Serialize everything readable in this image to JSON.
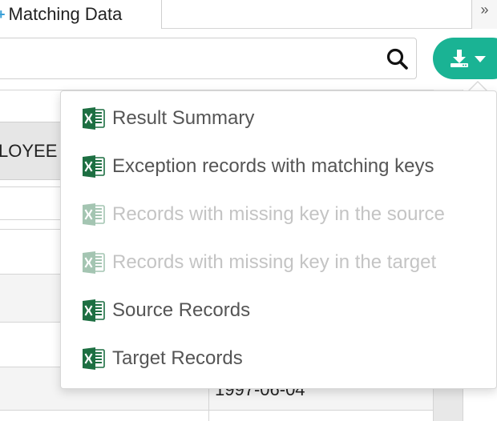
{
  "tab": {
    "label": "Matching Data"
  },
  "overflow": {
    "symbol": "»"
  },
  "search": {
    "placeholder": "",
    "value": ""
  },
  "table": {
    "header_fragment": "LOYEE",
    "visible_date": "1997-06-04"
  },
  "export_menu": {
    "items": [
      {
        "label": "Result Summary",
        "enabled": true
      },
      {
        "label": "Exception records with matching keys",
        "enabled": true
      },
      {
        "label": "Records with missing key in the source",
        "enabled": false
      },
      {
        "label": "Records with missing key in the target",
        "enabled": false
      },
      {
        "label": "Source Records",
        "enabled": true
      },
      {
        "label": "Target Records",
        "enabled": true
      }
    ]
  },
  "colors": {
    "accent": "#1ab394",
    "excel_green": "#1d6f42",
    "disabled_text": "#c4c4c4",
    "menu_text": "#555555"
  }
}
